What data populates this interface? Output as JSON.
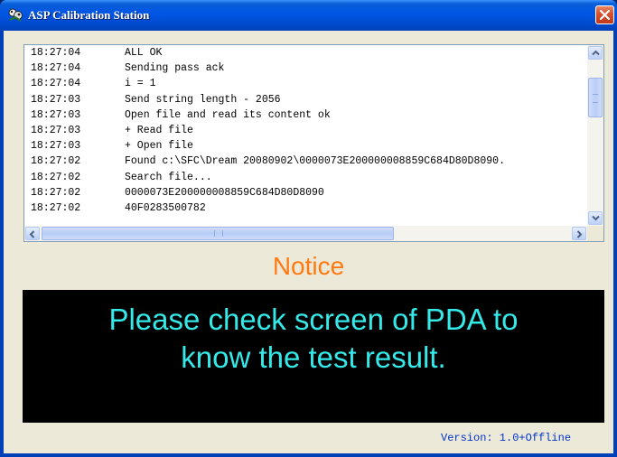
{
  "window": {
    "title": "ASP Calibration Station",
    "icon": "app-logo-icon"
  },
  "log": {
    "rows": [
      {
        "time": "18:27:04",
        "message": "ALL OK"
      },
      {
        "time": "18:27:04",
        "message": "Sending pass ack"
      },
      {
        "time": "18:27:04",
        "message": "i = 1"
      },
      {
        "time": "18:27:03",
        "message": "Send string length - 2056"
      },
      {
        "time": "18:27:03",
        "message": "Open file and read its content ok"
      },
      {
        "time": "18:27:03",
        "message": "+ Read file"
      },
      {
        "time": "18:27:03",
        "message": "+ Open file"
      },
      {
        "time": "18:27:02",
        "message": "Found c:\\SFC\\Dream 20080902\\0000073E200000008859C684D80D8090."
      },
      {
        "time": "18:27:02",
        "message": "Search file..."
      },
      {
        "time": "18:27:02",
        "message": "0000073E200000008859C684D80D8090"
      },
      {
        "time": "18:27:02",
        "message": "40F0283500782"
      }
    ]
  },
  "notice": {
    "heading": "Notice",
    "line1": "Please check screen of PDA to",
    "line2": "know the test result."
  },
  "version_text": "Version: 1.0+Offline",
  "colors": {
    "titlebar": "#0055e5",
    "notice_heading": "#ff7a12",
    "result_text": "#35e9e9",
    "result_background": "#000000",
    "version_text": "#0033cc",
    "client_background": "#ece9d8"
  }
}
